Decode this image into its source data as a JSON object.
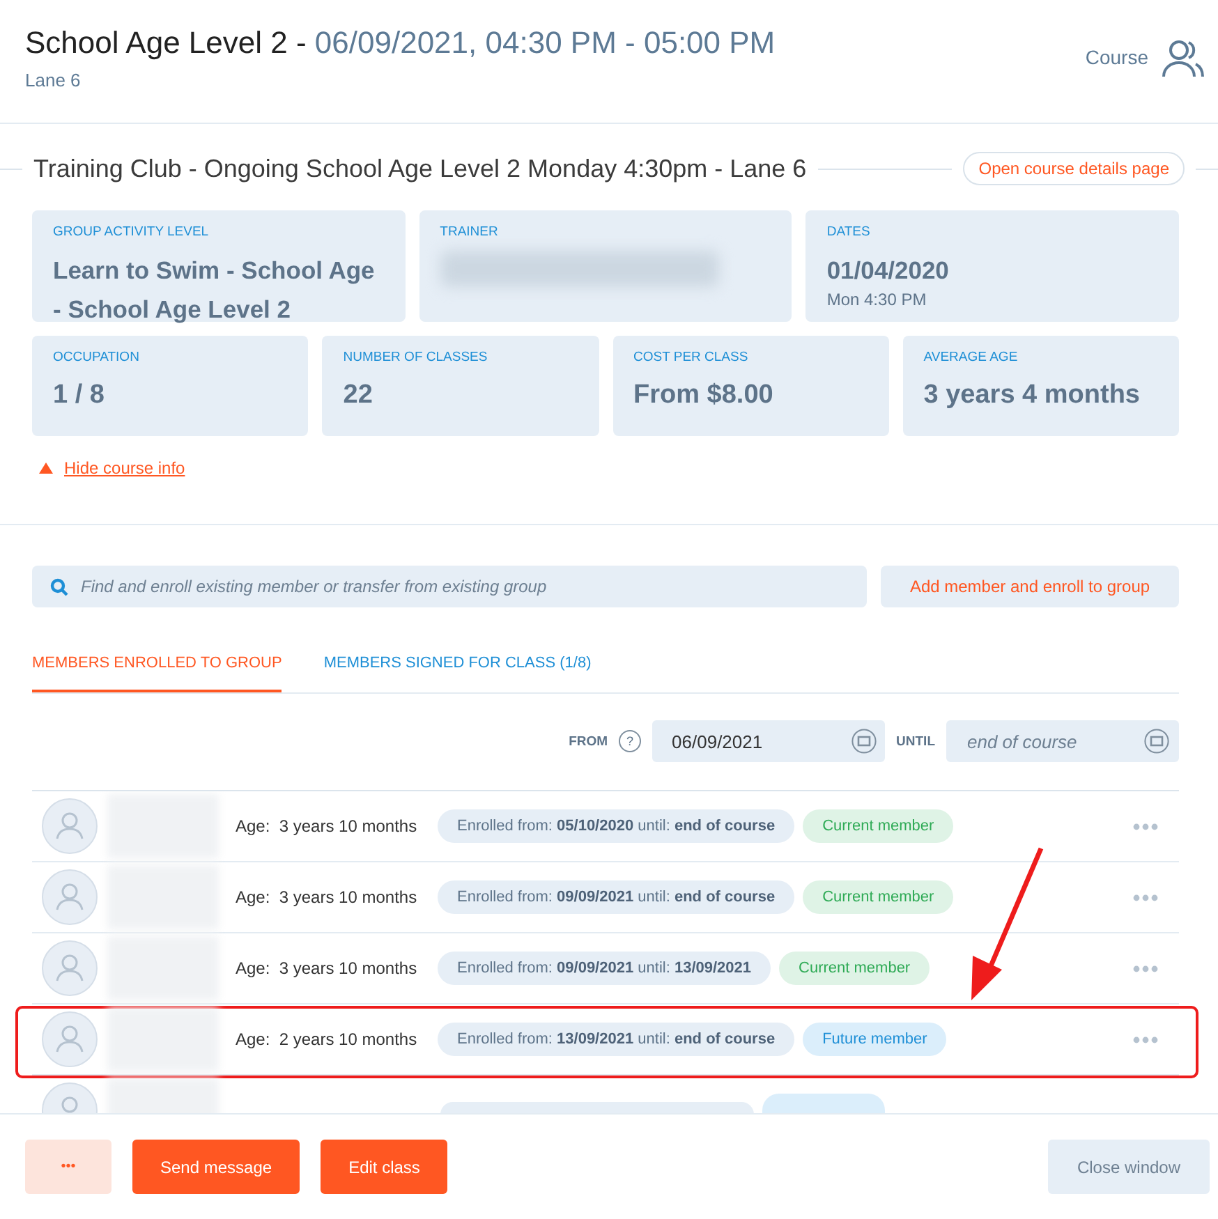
{
  "header": {
    "title": "School Age Level 2 - ",
    "datetime": "06/09/2021, 04:30 PM - 05:00 PM",
    "subtitle": "Lane 6",
    "type_label": "Course"
  },
  "course": {
    "name": "Training Club - Ongoing School Age Level 2 Monday 4:30pm - Lane 6",
    "details_link": "Open course details page"
  },
  "info_top": [
    {
      "label": "GROUP ACTIVITY LEVEL",
      "value": "Learn to Swim - School Age - School Age Level 2",
      "kind": "text"
    },
    {
      "label": "TRAINER",
      "kind": "redacted"
    },
    {
      "label": "DATES",
      "value": "01/04/2020",
      "note": "Mon 4:30 PM",
      "kind": "text"
    }
  ],
  "info_bottom": [
    {
      "label": "OCCUPATION",
      "value": "1 / 8"
    },
    {
      "label": "NUMBER OF CLASSES",
      "value": "22"
    },
    {
      "label": "COST PER CLASS",
      "value": "From $8.00"
    },
    {
      "label": "AVERAGE AGE",
      "value": "3 years 4 months"
    }
  ],
  "hide_info": "Hide course info",
  "search": {
    "placeholder": "Find and enroll existing member or transfer from existing group"
  },
  "add_button": "Add member and enroll to group",
  "tabs": [
    {
      "label": "MEMBERS ENROLLED TO GROUP",
      "selected": true
    },
    {
      "label": "MEMBERS SIGNED FOR CLASS (1/8)",
      "selected": false
    }
  ],
  "filter": {
    "from_label": "FROM",
    "help": "?",
    "from_value": "06/09/2021",
    "until_label": "UNTIL",
    "until_placeholder": "end of course"
  },
  "members": [
    {
      "age_label": "Age:",
      "age": "3 years 10 months",
      "enrolled_from_label": "Enrolled from:",
      "from": "05/10/2020",
      "until_label": "until:",
      "until": "end of course",
      "status": "Current member",
      "kind": "current",
      "highlighted": false
    },
    {
      "age_label": "Age:",
      "age": "3 years 10 months",
      "enrolled_from_label": "Enrolled from:",
      "from": "09/09/2021",
      "until_label": "until:",
      "until": "end of course",
      "status": "Current member",
      "kind": "current",
      "highlighted": false
    },
    {
      "age_label": "Age:",
      "age": "3 years 10 months",
      "enrolled_from_label": "Enrolled from:",
      "from": "09/09/2021",
      "until_label": "until:",
      "until": "13/09/2021",
      "status": "Current member",
      "kind": "current",
      "highlighted": false
    },
    {
      "age_label": "Age:",
      "age": "2 years 10 months",
      "enrolled_from_label": "Enrolled from:",
      "from": "13/09/2021",
      "until_label": "until:",
      "until": "end of course",
      "status": "Future member",
      "kind": "future",
      "highlighted": true
    }
  ],
  "partial_row": {
    "kind": "future"
  },
  "footer": {
    "more": "•••",
    "send": "Send message",
    "edit": "Edit class",
    "close": "Close window"
  }
}
